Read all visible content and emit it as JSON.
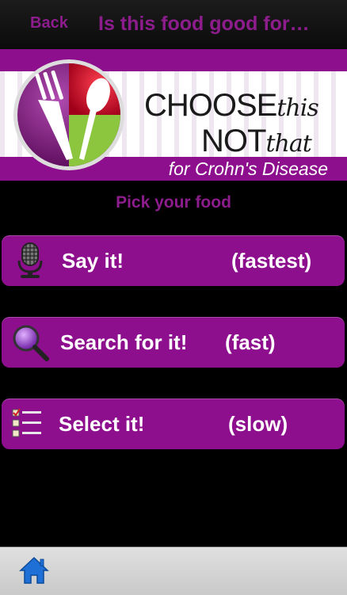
{
  "nav": {
    "back_label": "Back",
    "title": "Is this food good for…"
  },
  "banner": {
    "brand_choose": "CHOOSE",
    "brand_this": "this",
    "brand_not": "NOT",
    "brand_that": "that",
    "tagline": "for Crohn's Disease"
  },
  "content": {
    "pick_label": "Pick your food"
  },
  "options": [
    {
      "label": "Say it!",
      "speed": "(fastest)",
      "icon": "microphone-icon"
    },
    {
      "label": "Search for it!",
      "speed": "(fast)",
      "icon": "magnifier-icon"
    },
    {
      "label": "Select it!",
      "speed": "(slow)",
      "icon": "checklist-icon"
    }
  ],
  "toolbar": {
    "home_icon": "home-icon"
  },
  "colors": {
    "accent": "#8d0f8d",
    "accent_text": "#8d1c8d",
    "background": "#000000"
  }
}
